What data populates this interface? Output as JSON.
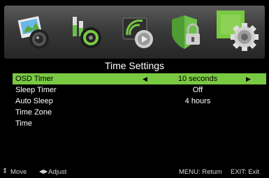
{
  "title": "Time Settings",
  "menu_icons": [
    {
      "name": "picture-menu-icon"
    },
    {
      "name": "sound-menu-icon"
    },
    {
      "name": "channel-menu-icon"
    },
    {
      "name": "lock-menu-icon"
    },
    {
      "name": "setup-menu-icon",
      "active": true
    }
  ],
  "rows": [
    {
      "label": "OSD Timer",
      "value": "10 seconds",
      "selected": true
    },
    {
      "label": "Sleep Timer",
      "value": "Off"
    },
    {
      "label": "Auto Sleep",
      "value": "4 hours"
    },
    {
      "label": "Time Zone",
      "value": ""
    },
    {
      "label": "Time",
      "value": ""
    }
  ],
  "footer": {
    "move": "Move",
    "adjust": "Adjust",
    "menu": "MENU: Return",
    "exit": "EXIT: Exit"
  },
  "colors": {
    "highlight": "#7ac943",
    "background": "#000000"
  }
}
